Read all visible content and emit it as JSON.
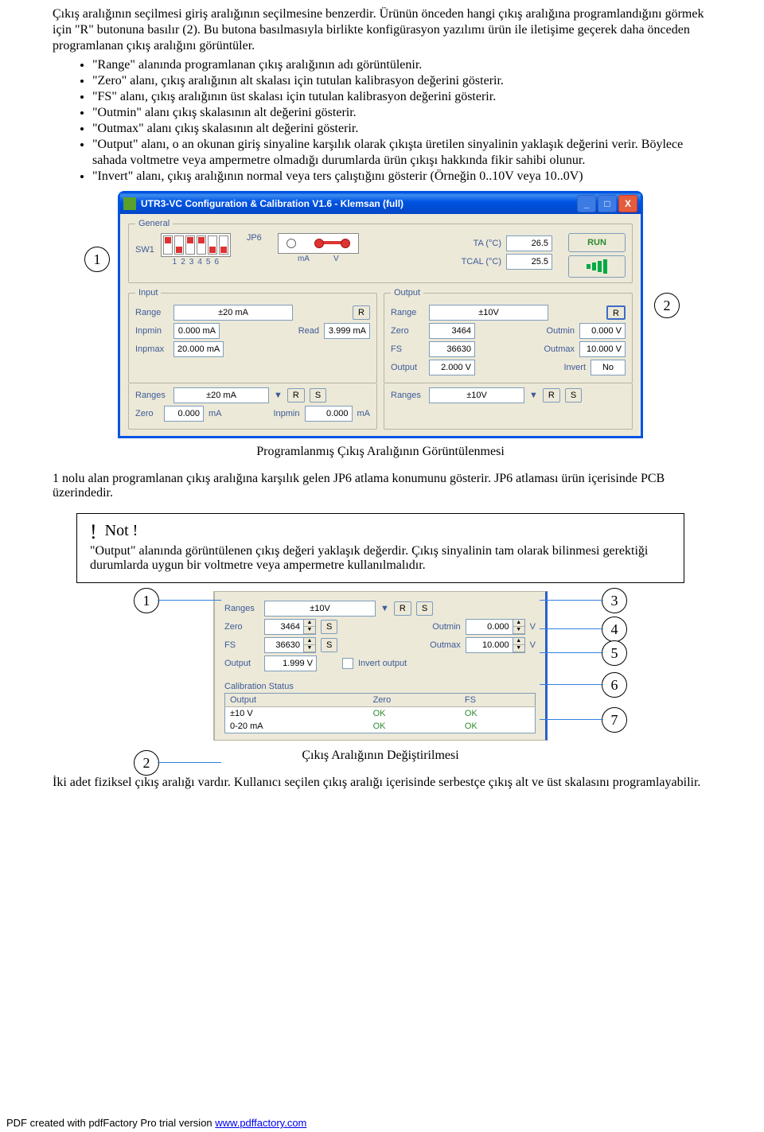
{
  "intro": {
    "p1": "Çıkış aralığının seçilmesi giriş aralığının seçilmesine benzerdir. Ürünün önceden hangi çıkış aralığına programlandığını görmek için \"R\" butonuna basılır (2). Bu butona basılmasıyla birlikte konfigürasyon yazılımı ürün ile iletişime geçerek daha önceden programlanan çıkış aralığını görüntüler."
  },
  "bullets": [
    "\"Range\" alanında programlanan çıkış aralığının adı görüntülenir.",
    "\"Zero\" alanı, çıkış aralığının alt skalası için tutulan kalibrasyon değerini gösterir.",
    "\"FS\" alanı, çıkış aralığının üst skalası için tutulan kalibrasyon değerini gösterir.",
    "\"Outmin\" alanı çıkış skalasının alt değerini gösterir.",
    "\"Outmax\" alanı çıkış skalasının alt değerini gösterir.",
    "\"Output\" alanı, o an okunan giriş sinyaline karşılık olarak çıkışta üretilen sinyalinin yaklaşık değerini verir. Böylece sahada voltmetre veya ampermetre olmadığı durumlarda ürün çıkışı hakkında fikir sahibi olunur.",
    "\"Invert\" alanı, çıkış aralığının normal veya ters çalıştığını gösterir (Örneğin 0..10V veya 10..0V)"
  ],
  "app": {
    "title": "UTR3-VC Configuration & Calibration V1.6 - Klemsan (full)",
    "min": "_",
    "max": "□",
    "close": "X",
    "run": "RUN",
    "general": {
      "legend": "General",
      "sw1": "SW1",
      "nums": [
        "1",
        "2",
        "3",
        "4",
        "5",
        "6"
      ],
      "jp6": "JP6",
      "ma": "mA",
      "v": "V",
      "ta": "TA (°C)",
      "taval": "26.5",
      "tcal": "TCAL (°C)",
      "tcalval": "25.5"
    },
    "input": {
      "legend": "Input",
      "range": "Range",
      "rangeval": "±20 mA",
      "r": "R",
      "inpmin": "Inpmin",
      "inpminval": "0.000 mA",
      "read": "Read",
      "readval": "3.999 mA",
      "inpmax": "Inpmax",
      "inpmaxval": "20.000 mA"
    },
    "output": {
      "legend": "Output",
      "range": "Range",
      "rangeval": "±10V",
      "r": "R",
      "zero": "Zero",
      "zeroval": "3464",
      "outmin": "Outmin",
      "outminval": "0.000 V",
      "fs": "FS",
      "fsval": "36630",
      "outmax": "Outmax",
      "outmaxval": "10.000 V",
      "output": "Output",
      "outputval": "2.000 V",
      "invert": "Invert",
      "invertval": "No"
    },
    "inbottom": {
      "ranges": "Ranges",
      "rangesval": "±20 mA",
      "r": "R",
      "s": "S",
      "zero": "Zero",
      "zeroval": "0.000",
      "ma": "mA",
      "inpmin": "Inpmin",
      "inpminval": "0.000",
      "ma2": "mA"
    },
    "outbottom": {
      "ranges": "Ranges",
      "rangesval": "±10V",
      "r": "R",
      "s": "S"
    }
  },
  "caption1": "Programlanmış Çıkış Aralığının Görüntülenmesi",
  "para1": "1 nolu alan programlanan çıkış aralığına karşılık gelen JP6 atlama konumunu gösterir. JP6 atlaması ürün içerisinde PCB üzerindedir.",
  "note": {
    "bang": "!",
    "title": "Not !",
    "body": "\"Output\" alanında görüntülenen çıkış değeri yaklaşık değerdir. Çıkış sinyalinin tam olarak bilinmesi gerektiği durumlarda uygun bir voltmetre veya ampermetre kullanılmalıdır."
  },
  "mid": {
    "ranges": "Ranges",
    "rangesval": "±10V",
    "r": "R",
    "s": "S",
    "zero": "Zero",
    "zeroval": "3464",
    "outmin": "Outmin",
    "outminval": "0.000",
    "vu": "V",
    "fs": "FS",
    "fsval": "36630",
    "outmax": "Outmax",
    "outmaxval": "10.000",
    "vu2": "V",
    "output": "Output",
    "outputval": "1.999 V",
    "invertout": "Invert output",
    "cal": "Calibration Status",
    "th1": "Output",
    "th2": "Zero",
    "th3": "FS",
    "r1c1": "±10 V",
    "r1c2": "OK",
    "r1c3": "OK",
    "r2c1": "0-20 mA",
    "r2c2": "OK",
    "r2c3": "OK"
  },
  "caption2": "Çıkış Aralığının Değiştirilmesi",
  "para2": "İki adet fiziksel çıkış aralığı vardır. Kullanıcı seçilen çıkış aralığı içerisinde serbestçe çıkış alt ve üst skalasını programlayabilir.",
  "callouts": {
    "c1": "1",
    "c2": "2",
    "c3": "3",
    "c4": "4",
    "c5": "5",
    "c6": "6",
    "c7": "7"
  },
  "footer": {
    "text": "PDF created with pdfFactory Pro trial version ",
    "link": "www.pdffactory.com"
  }
}
